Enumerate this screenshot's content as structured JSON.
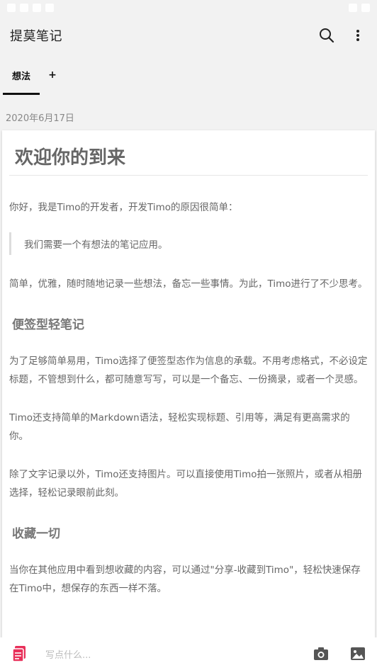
{
  "app": {
    "title": "提莫笔记"
  },
  "tabs": [
    {
      "label": "想法",
      "active": true
    },
    {
      "label": "+",
      "active": false
    }
  ],
  "note": {
    "date": "2020年6月17日",
    "title": "欢迎你的到来",
    "intro": "你好，我是Timo的开发者，开发Timo的原因很简单：",
    "quote": "我们需要一个有想法的笔记应用。",
    "para1": "简单，优雅，随时随地记录一些想法，备忘一些事情。为此，Timo进行了不少思考。",
    "heading1": "便签型轻笔记",
    "para2": "为了足够简单易用，Timo选择了便签型态作为信息的承载。不用考虑格式，不必设定标题，不管想到什么，都可随意写写，可以是一个备忘、一份摘录，或者一个灵感。",
    "para3": "Timo还支持简单的Markdown语法，轻松实现标题、引用等，满足有更高需求的你。",
    "para4": "除了文字记录以外，Timo还支持图片。可以直接使用Timo拍一张照片，或者从相册选择，轻松记录眼前此刻。",
    "heading2": "收藏一切",
    "para5": "当你在其他应用中看到想收藏的内容，可以通过\"分享-收藏到Timo\"，轻松快速保存在Timo中，想保存的东西一样不落。"
  },
  "composer": {
    "placeholder": "写点什么..."
  },
  "icons": {
    "search": "search-icon",
    "more": "more-vert-icon",
    "notes": "notes-icon",
    "camera": "camera-icon",
    "image": "image-icon"
  },
  "colors": {
    "accent": "#e8305a"
  }
}
